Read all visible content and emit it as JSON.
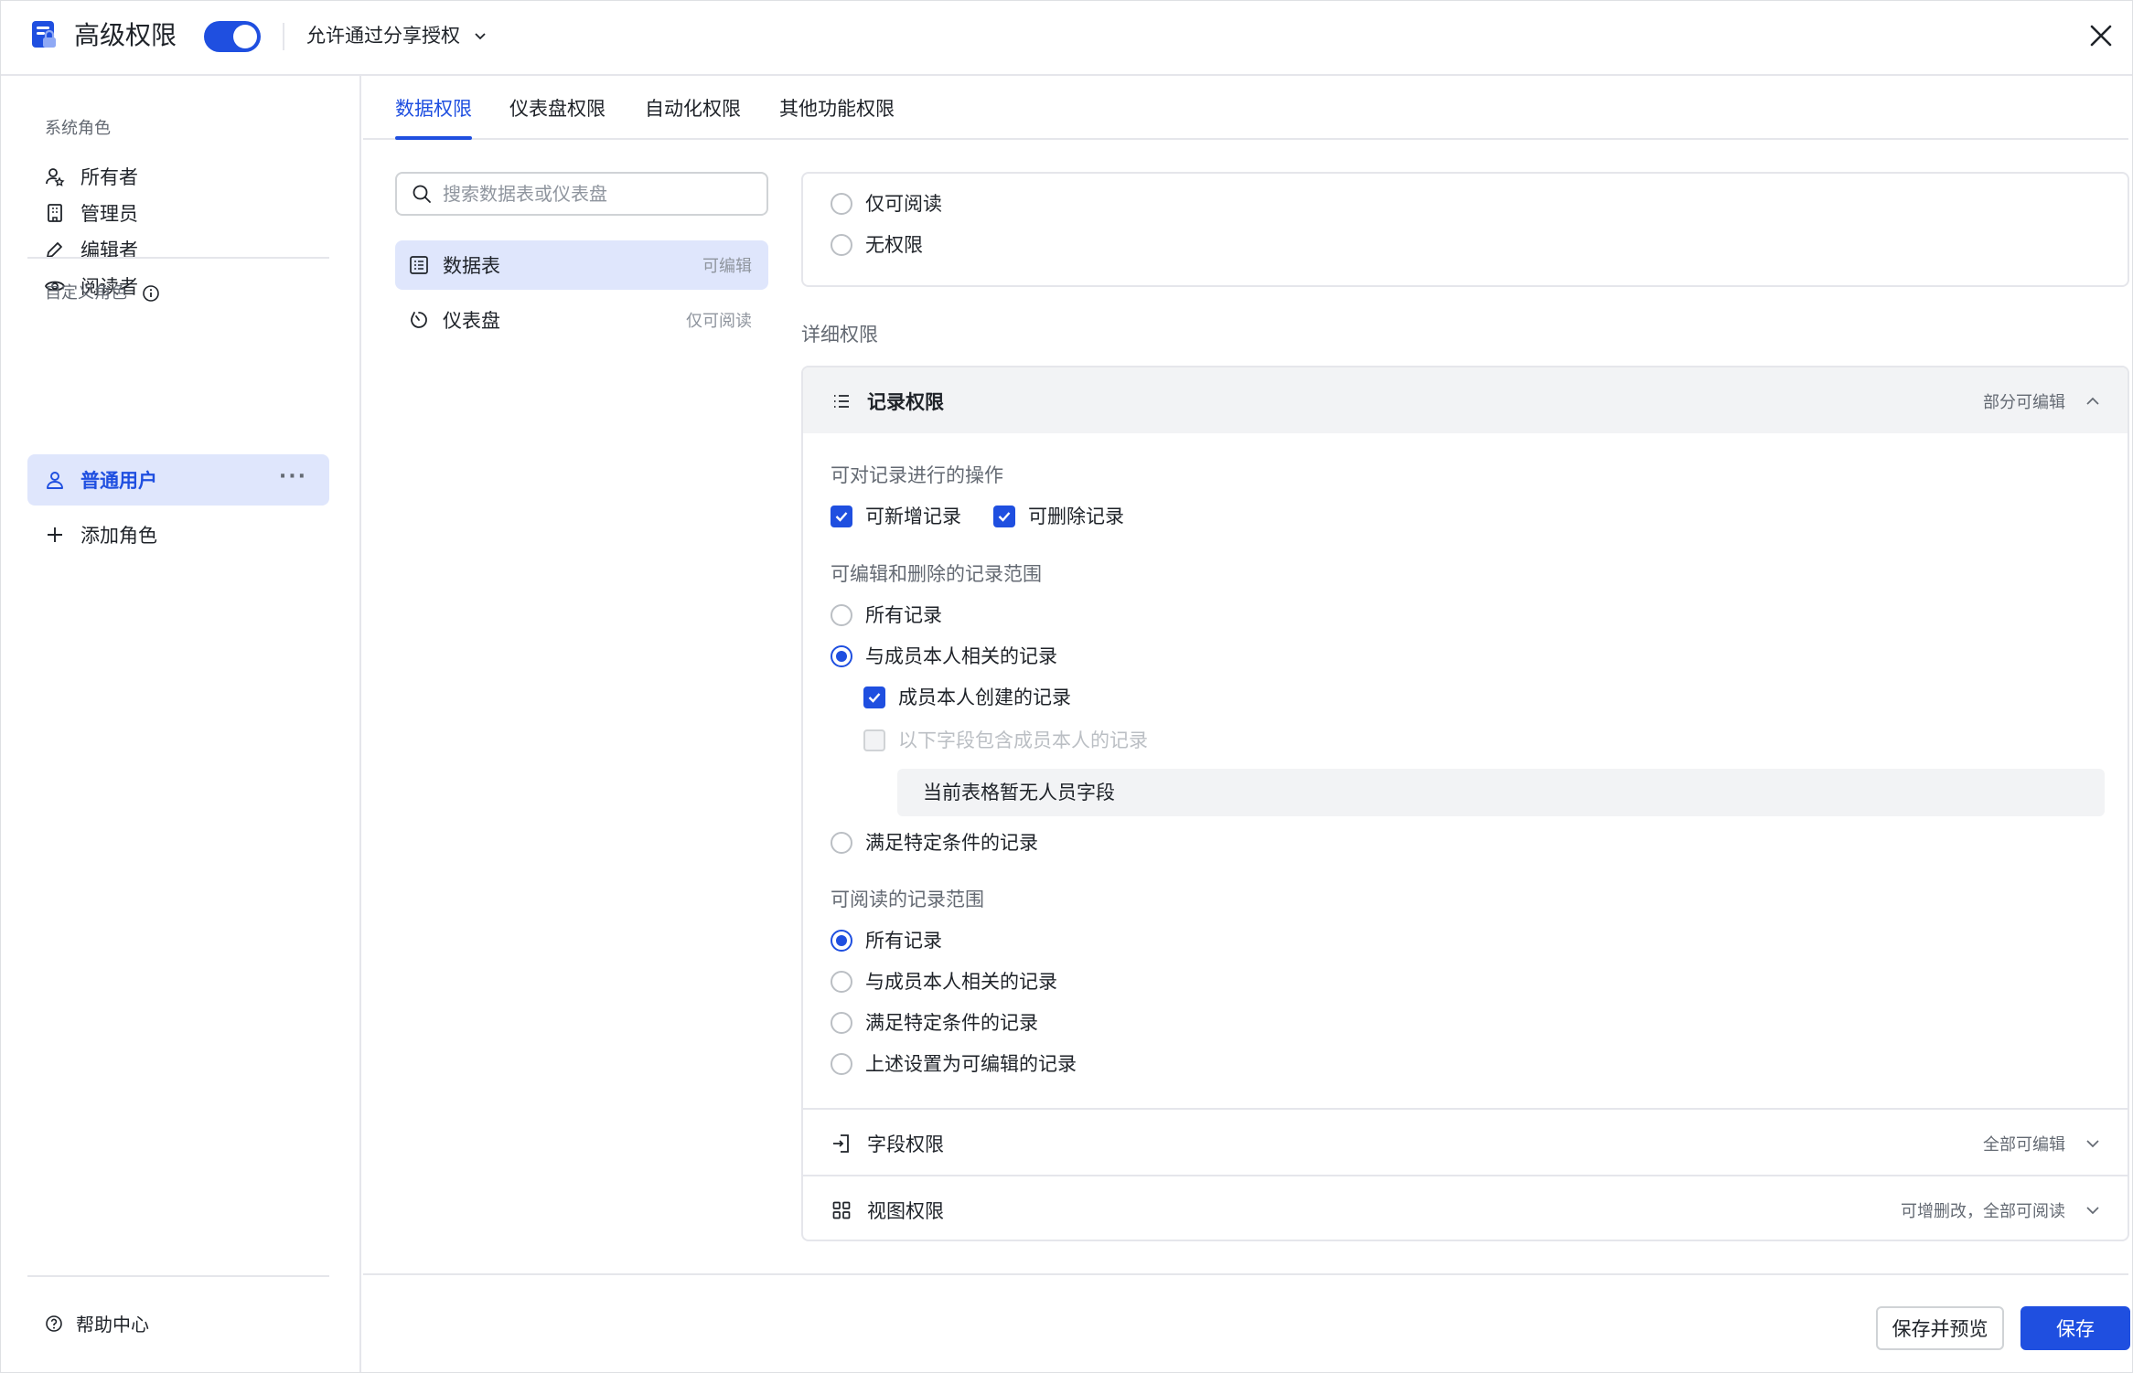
{
  "header": {
    "title": "高级权限",
    "toggle_on": true,
    "share_option": "允许通过分享授权"
  },
  "sidebar": {
    "system_roles_label": "系统角色",
    "system_roles": [
      {
        "label": "所有者",
        "icon": "owner-icon"
      },
      {
        "label": "管理员",
        "icon": "admin-icon"
      },
      {
        "label": "编辑者",
        "icon": "pencil-icon"
      },
      {
        "label": "阅读者",
        "icon": "eye-icon"
      }
    ],
    "custom_roles_label": "自定义角色",
    "custom_roles": [
      {
        "label": "普通用户",
        "icon": "user-icon",
        "active": true
      }
    ],
    "add_role": "添加角色",
    "help": "帮助中心"
  },
  "tabs": [
    {
      "label": "数据权限",
      "active": true
    },
    {
      "label": "仪表盘权限"
    },
    {
      "label": "自动化权限"
    },
    {
      "label": "其他功能权限"
    }
  ],
  "search": {
    "placeholder": "搜索数据表或仪表盘"
  },
  "tables": [
    {
      "label": "数据表",
      "status": "可编辑",
      "icon": "table-icon",
      "active": true
    },
    {
      "label": "仪表盘",
      "status": "仅可阅读",
      "icon": "dashboard-icon"
    }
  ],
  "top_options": [
    {
      "label": "仅可阅读",
      "selected": false
    },
    {
      "label": "无权限",
      "selected": false
    }
  ],
  "detail_label": "详细权限",
  "record_perm": {
    "title": "记录权限",
    "status": "部分可编辑",
    "ops_label": "可对记录进行的操作",
    "ops": [
      {
        "label": "可新增记录",
        "checked": true
      },
      {
        "label": "可删除记录",
        "checked": true
      }
    ],
    "edit_scope_label": "可编辑和删除的记录范围",
    "edit_scope": {
      "all": "所有记录",
      "related": "与成员本人相关的记录",
      "created_by": "成员本人创建的记录",
      "field_contains": "以下字段包含成员本人的记录",
      "no_person_field": "当前表格暂无人员字段",
      "conditional": "满足特定条件的记录"
    },
    "read_scope_label": "可阅读的记录范围",
    "read_scope": [
      {
        "label": "所有记录",
        "selected": true
      },
      {
        "label": "与成员本人相关的记录",
        "selected": false
      },
      {
        "label": "满足特定条件的记录",
        "selected": false
      },
      {
        "label": "上述设置为可编辑的记录",
        "selected": false
      }
    ]
  },
  "field_perm": {
    "title": "字段权限",
    "status": "全部可编辑"
  },
  "view_perm": {
    "title": "视图权限",
    "status": "可增删改，全部可阅读"
  },
  "footer": {
    "save_preview": "保存并预览",
    "save": "保存"
  },
  "colors": {
    "accent": "#1f4fe0",
    "active_bg": "#dfe6fc",
    "muted_text": "#646a73",
    "border": "#e5e6eb"
  }
}
